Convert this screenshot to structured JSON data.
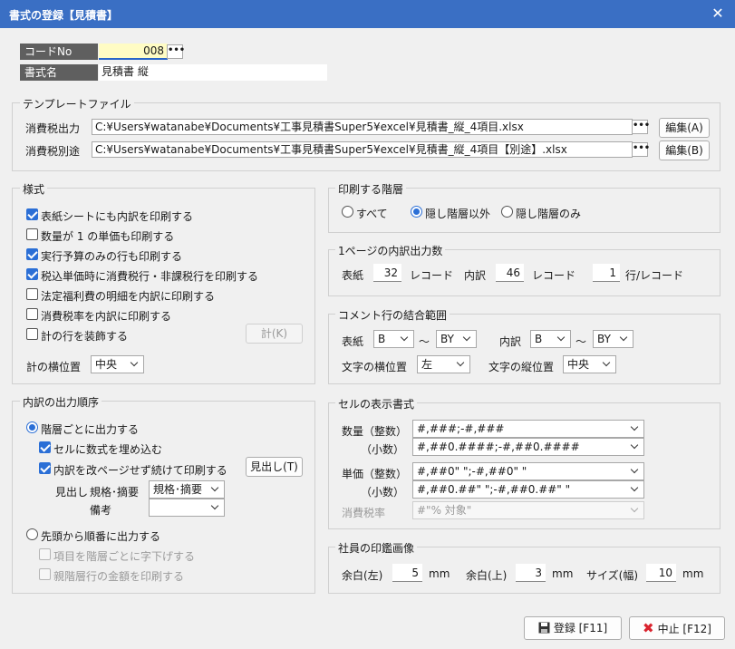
{
  "window": {
    "title": "書式の登録【見積書】"
  },
  "code": {
    "label": "コードNo",
    "value": "008"
  },
  "format_name": {
    "label": "書式名",
    "value": "見積書 縦"
  },
  "template": {
    "title": "テンプレートファイル",
    "tax_out": {
      "label": "消費税出力",
      "path": "C:¥Users¥watanabe¥Documents¥工事見積書Super5¥excel¥見積書_縦_4項目.xlsx",
      "edit": "編集(A)"
    },
    "tax_sep": {
      "label": "消費税別途",
      "path": "C:¥Users¥watanabe¥Documents¥工事見積書Super5¥excel¥見積書_縦_4項目【別途】.xlsx",
      "edit": "編集(B)"
    }
  },
  "style": {
    "title": "様式",
    "items": [
      {
        "label": "表紙シートにも内訳を印刷する",
        "checked": true
      },
      {
        "label": "数量が 1 の単価も印刷する",
        "checked": false
      },
      {
        "label": "実行予算のみの行も印刷する",
        "checked": true
      },
      {
        "label": "税込単価時に消費税行・非課税行を印刷する",
        "checked": true
      },
      {
        "label": "法定福利費の明細を内訳に印刷する",
        "checked": false
      },
      {
        "label": "消費税率を内訳に印刷する",
        "checked": false
      },
      {
        "label": "計の行を装飾する",
        "checked": false
      }
    ],
    "sum_button": "計(K)",
    "sum_pos_label": "計の横位置",
    "sum_pos_value": "中央"
  },
  "print_level": {
    "title": "印刷する階層",
    "options": [
      "すべて",
      "隠し階層以外",
      "隠し階層のみ"
    ],
    "selected": 1
  },
  "lines_per_page": {
    "title": "1ページの内訳出力数",
    "cover_label": "表紙",
    "cover_value": "32",
    "cover_unit": "レコード",
    "detail_label": "内訳",
    "detail_value": "46",
    "detail_unit": "レコード",
    "row_value": "1",
    "row_unit": "行/レコード"
  },
  "comment_range": {
    "title": "コメント行の結合範囲",
    "cover_label": "表紙",
    "cover_from": "B",
    "cover_to": "BY",
    "detail_label": "内訳",
    "detail_from": "B",
    "detail_to": "BY",
    "tilde": "～",
    "h_label": "文字の横位置",
    "h_value": "左",
    "v_label": "文字の縦位置",
    "v_value": "中央"
  },
  "output_order": {
    "title": "内訳の出力順序",
    "opt1": "階層ごとに出力する",
    "opt1_sub1": "セルに数式を埋め込む",
    "opt1_sub2": "内訳を改ページせず続けて印刷する",
    "heading_button": "見出し(T)",
    "heading_label": "見出し",
    "spec_label": "規格･摘要",
    "spec_value": "規格･摘要",
    "note_label": "備考",
    "note_value": "",
    "opt2": "先頭から順番に出力する",
    "opt2_sub1": "項目を階層ごとに字下げする",
    "opt2_sub2": "親階層行の金額を印刷する"
  },
  "cell_format": {
    "title": "セルの表示書式",
    "qty_int_label": "数量（整数）",
    "qty_int": "#,###;-#,###",
    "qty_dec_label": "（小数）",
    "qty_dec": "#,##0.####;-#,##0.####",
    "price_int_label": "単価（整数）",
    "price_int": "#,##0\" \";-#,##0\" \"",
    "price_dec_label": "（小数）",
    "price_dec": "#,##0.##\" \";-#,##0.##\" \"",
    "tax_label": "消費税率",
    "tax": "#\"% 対象\""
  },
  "stamp": {
    "title": "社員の印鑑画像",
    "left_label": "余白(左)",
    "left_value": "5",
    "left_unit": "mm",
    "top_label": "余白(上)",
    "top_value": "3",
    "top_unit": "mm",
    "size_label": "サイズ(幅)",
    "size_value": "10",
    "size_unit": "mm"
  },
  "buttons": {
    "register": "登録 [F11]",
    "cancel": "中止 [F12]"
  },
  "colors": {
    "titlebar": "#3a6fc4",
    "accent": "#2b6fd6",
    "cancel_icon": "#d9232e"
  }
}
